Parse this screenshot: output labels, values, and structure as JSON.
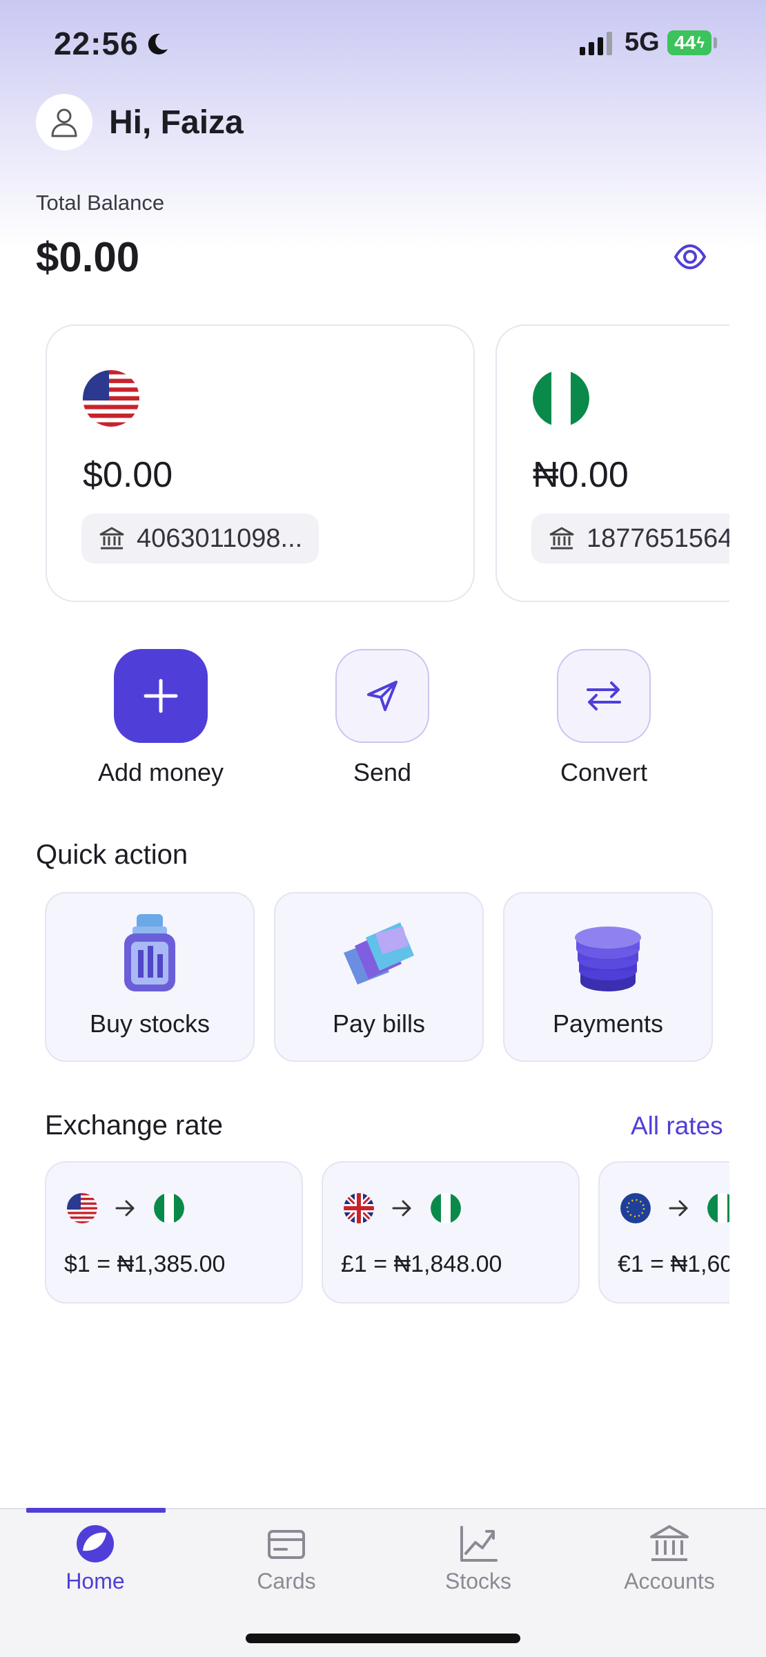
{
  "status_bar": {
    "time": "22:56",
    "network": "5G",
    "battery": "44",
    "icons": [
      "moon-icon",
      "signal-icon",
      "battery-icon"
    ]
  },
  "header": {
    "greeting": "Hi, Faiza",
    "avatar_icon": "user-icon"
  },
  "balance": {
    "label": "Total Balance",
    "amount": "$0.00",
    "visibility_icon": "eye-icon"
  },
  "wallets": [
    {
      "currency": "USD",
      "flag": "us-flag-icon",
      "amount": "$0.00",
      "account": "4063011098..."
    },
    {
      "currency": "NGN",
      "flag": "ng-flag-icon",
      "amount": "₦0.00",
      "account": "1877651564"
    }
  ],
  "actions": {
    "add_money": "Add money",
    "send": "Send",
    "convert": "Convert"
  },
  "quick_action": {
    "title": "Quick action",
    "items": [
      {
        "label": "Buy stocks",
        "icon": "stocks-jar-icon"
      },
      {
        "label": "Pay bills",
        "icon": "bills-icon"
      },
      {
        "label": "Payments",
        "icon": "payments-stack-icon"
      }
    ]
  },
  "exchange": {
    "title": "Exchange rate",
    "all_rates": "All rates",
    "rates": [
      {
        "from": "us-flag-icon",
        "to": "ng-flag-icon",
        "text": "$1 = ₦1,385.00"
      },
      {
        "from": "gb-flag-icon",
        "to": "ng-flag-icon",
        "text": "£1 = ₦1,848.00"
      },
      {
        "from": "eu-flag-icon",
        "to": "ng-flag-icon",
        "text": "€1 = ₦1,60"
      }
    ]
  },
  "tabs": [
    {
      "label": "Home",
      "icon": "home-icon",
      "active": true
    },
    {
      "label": "Cards",
      "icon": "card-icon",
      "active": false
    },
    {
      "label": "Stocks",
      "icon": "chart-icon",
      "active": false
    },
    {
      "label": "Accounts",
      "icon": "bank-icon",
      "active": false
    }
  ],
  "colors": {
    "accent": "#4f3fd8",
    "card_bg": "#f5f5fd",
    "positive_battery": "#3cc35b"
  }
}
